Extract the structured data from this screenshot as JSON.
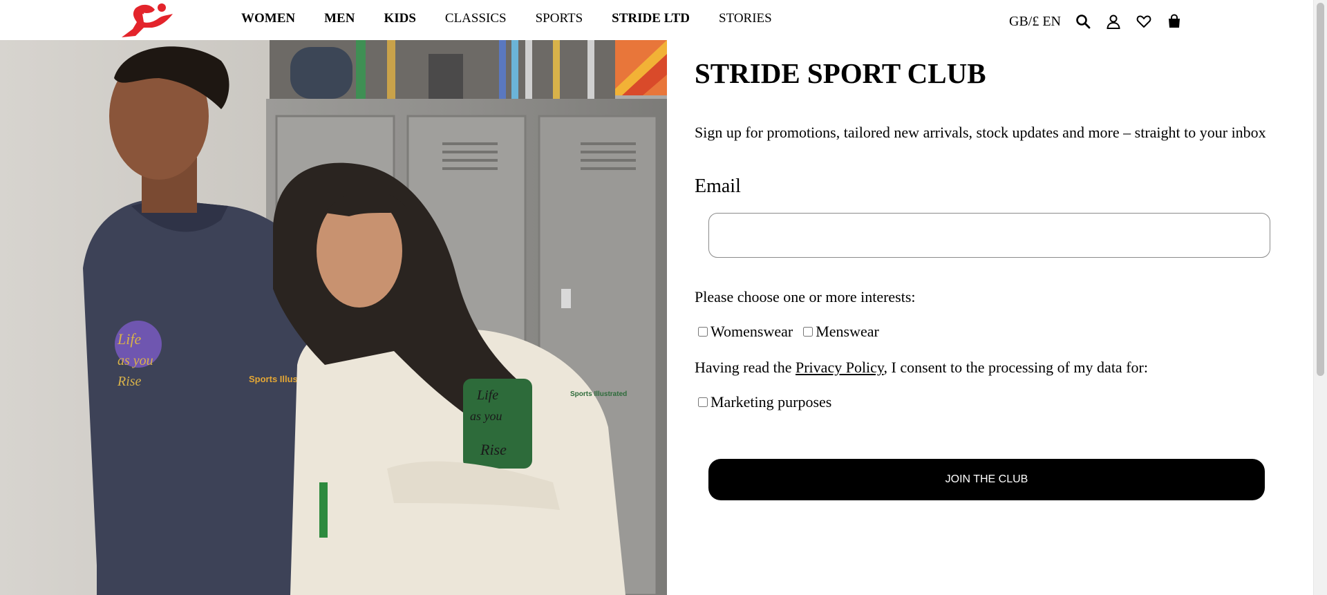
{
  "header": {
    "logo": {
      "name": "stride-runner-logo",
      "color": "#e3242b"
    },
    "nav": [
      {
        "label": "WOMEN",
        "bold": true
      },
      {
        "label": "MEN",
        "bold": true
      },
      {
        "label": "KIDS",
        "bold": true
      },
      {
        "label": "CLASSICS",
        "bold": false
      },
      {
        "label": "SPORTS",
        "bold": false
      },
      {
        "label": "STRIDE LTD",
        "bold": true
      },
      {
        "label": "STORIES",
        "bold": false
      }
    ],
    "locale": "GB/£ EN",
    "icons": [
      "search-icon",
      "account-icon",
      "wishlist-heart-icon",
      "shopping-bag-icon"
    ]
  },
  "hero": {
    "alt_subject": "photo",
    "print_a": "Sports Illustrated",
    "print_b": "Sports Illustrated"
  },
  "form": {
    "title": "STRIDE SPORT CLUB",
    "intro": "Sign up for promotions, tailored new arrivals, stock updates and more – straight to your inbox",
    "email_label": "Email",
    "email_value": "",
    "email_placeholder": "",
    "interests_prompt": "Please choose one or more interests:",
    "interests": [
      {
        "label": "Womenswear",
        "checked": false
      },
      {
        "label": "Menswear",
        "checked": false
      }
    ],
    "consent_prefix": "Having read the ",
    "consent_link": "Privacy Policy",
    "consent_suffix": ", I consent to the processing of my data for:",
    "marketing_label": "Marketing purposes",
    "marketing_checked": false,
    "submit_label": "JOIN THE CLUB"
  },
  "colors": {
    "brand_red": "#e3242b",
    "button_bg": "#000000",
    "button_text": "#ffffff"
  }
}
